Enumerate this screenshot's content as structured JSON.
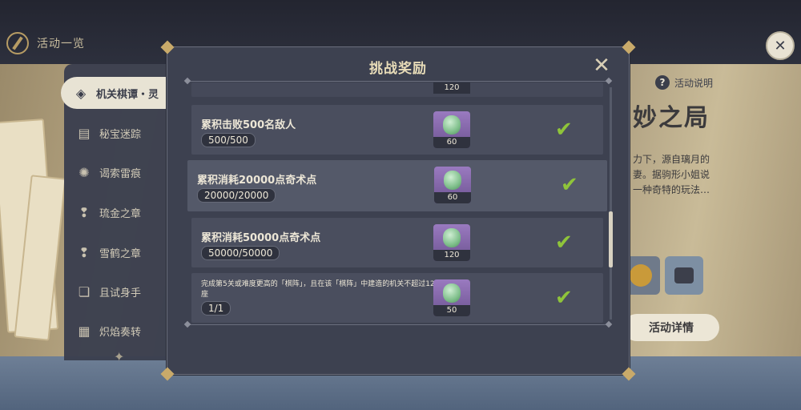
{
  "header": {
    "title": "活动一览"
  },
  "sidebar": {
    "items": [
      {
        "label": "机关棋谭・灵",
        "icon": "gear-diamond-icon",
        "active": true
      },
      {
        "label": "秘宝迷踪",
        "icon": "treasure-chest-icon"
      },
      {
        "label": "谒索雷痕",
        "icon": "spiral-icon"
      },
      {
        "label": "琉金之章",
        "icon": "pin-icon"
      },
      {
        "label": "雪鹤之章",
        "icon": "pin-icon"
      },
      {
        "label": "且试身手",
        "icon": "cards-icon"
      },
      {
        "label": "炽焰奏转",
        "icon": "grid-icon"
      }
    ]
  },
  "event": {
    "help_label": "活动说明",
    "title": "妙之局",
    "desc_lines": [
      "力下，源自璃月的",
      "妻。据驹形小姐说",
      "一种奇特的玩法…"
    ],
    "detail_button": "活动详情"
  },
  "modal": {
    "title": "挑战奖励",
    "partial_top_reward_qty": "120",
    "rows": [
      {
        "task": "累积击败500名敌人",
        "progress": "500/500",
        "reward_qty": "60",
        "done": true
      },
      {
        "task": "累积消耗20000点奇术点",
        "progress": "20000/20000",
        "reward_qty": "60",
        "done": true,
        "highlighted": true
      },
      {
        "task": "累积消耗50000点奇术点",
        "progress": "50000/50000",
        "reward_qty": "120",
        "done": true
      },
      {
        "task": "完成第5关或难度更高的「棋阵」，且在该「棋阵」中建造的机关不超过12座",
        "progress": "1/1",
        "reward_qty": "50",
        "done": true
      }
    ],
    "check_glyph": "✔",
    "close_glyph": "✕"
  },
  "colors": {
    "accent_gold": "#c9aa6a",
    "check_green": "#8fc43a",
    "reward_purple": "#8a6ab3"
  }
}
